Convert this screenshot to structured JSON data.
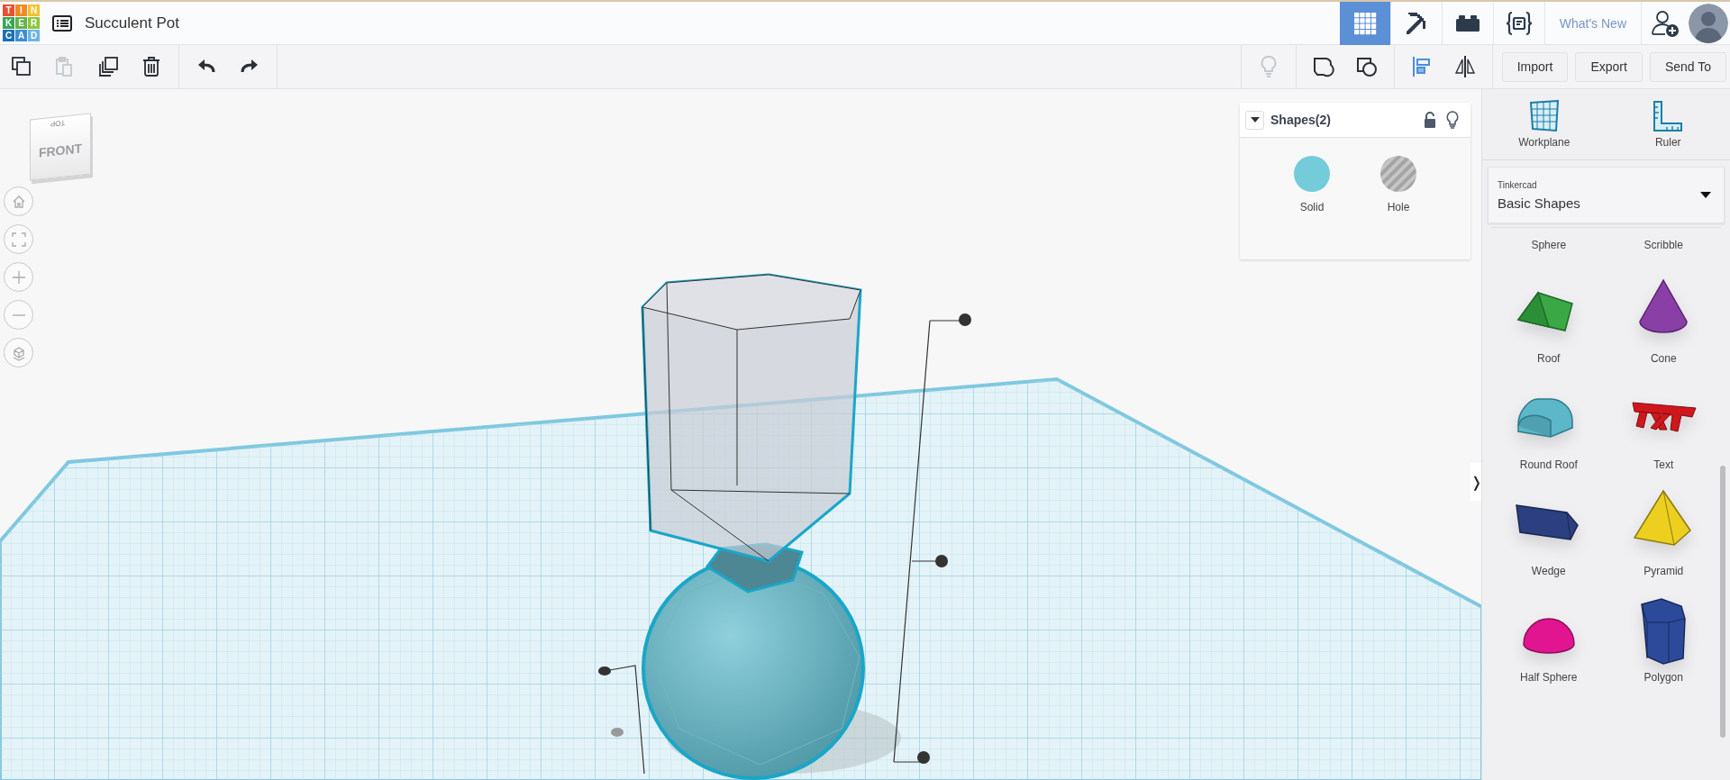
{
  "app": {
    "logo": [
      {
        "letter": "T",
        "color": "#e8502f"
      },
      {
        "letter": "I",
        "color": "#f08a24"
      },
      {
        "letter": "N",
        "color": "#f2c12e"
      },
      {
        "letter": "K",
        "color": "#3aa655"
      },
      {
        "letter": "E",
        "color": "#61b44a"
      },
      {
        "letter": "R",
        "color": "#8dc63f"
      },
      {
        "letter": "C",
        "color": "#1f6fb5"
      },
      {
        "letter": "A",
        "color": "#3c8fd1"
      },
      {
        "letter": "D",
        "color": "#6cb4e4"
      }
    ],
    "title": "Succulent Pot"
  },
  "top_nav": {
    "tabs": [
      {
        "kind": "grid",
        "selected": true
      },
      {
        "kind": "pickaxe",
        "selected": false
      },
      {
        "kind": "brick",
        "selected": false
      },
      {
        "kind": "codeblocks",
        "selected": false
      }
    ],
    "whats_new": "What's New"
  },
  "toolbar": {
    "left": [
      {
        "kind": "copy",
        "disabled": false
      },
      {
        "kind": "paste",
        "disabled": true
      },
      {
        "kind": "duplicate",
        "disabled": false
      },
      {
        "kind": "delete",
        "disabled": false
      },
      {
        "kind": "undo",
        "disabled": false
      },
      {
        "kind": "redo",
        "disabled": false
      }
    ],
    "right": [
      {
        "kind": "bulb",
        "disabled": true
      },
      {
        "kind": "group",
        "disabled": false
      },
      {
        "kind": "ungroup",
        "disabled": false
      },
      {
        "kind": "align",
        "disabled": false
      },
      {
        "kind": "mirror",
        "disabled": false
      }
    ],
    "buttons": [
      "Import",
      "Export",
      "Send To"
    ]
  },
  "view_cube": {
    "front": "FRONT",
    "top": "TOP"
  },
  "view_controls": [
    {
      "kind": "home"
    },
    {
      "kind": "fit"
    },
    {
      "kind": "zoom-in"
    },
    {
      "kind": "zoom-out"
    },
    {
      "kind": "perspective"
    }
  ],
  "shapes_panel": {
    "title": "Shapes(2)",
    "options": [
      {
        "kind": "solid",
        "label": "Solid"
      },
      {
        "kind": "hole",
        "label": "Hole"
      }
    ]
  },
  "sidebar": {
    "tools": [
      {
        "kind": "workplane",
        "label": "Workplane"
      },
      {
        "kind": "ruler",
        "label": "Ruler"
      }
    ],
    "library": {
      "caption": "Tinkercad",
      "value": "Basic Shapes"
    },
    "shapes": [
      {
        "kind": "cut",
        "label": "Sphere"
      },
      {
        "kind": "cut",
        "label": "Scribble"
      },
      {
        "kind": "roof",
        "label": "Roof"
      },
      {
        "kind": "cone",
        "label": "Cone"
      },
      {
        "kind": "round-roof",
        "label": "Round Roof"
      },
      {
        "kind": "text",
        "label": "Text"
      },
      {
        "kind": "wedge",
        "label": "Wedge"
      },
      {
        "kind": "pyramid",
        "label": "Pyramid"
      },
      {
        "kind": "half-sphere",
        "label": "Half Sphere"
      },
      {
        "kind": "polygon",
        "label": "Polygon"
      }
    ],
    "collapse": "❭"
  }
}
